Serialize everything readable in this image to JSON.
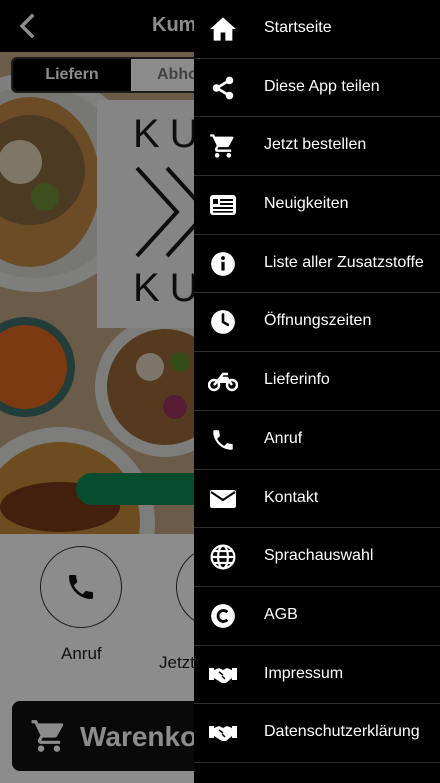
{
  "header": {
    "title": "Kumpel",
    "back_icon": "chevron-left-icon"
  },
  "delivery_toggle": {
    "options": [
      "Liefern",
      "Abholung"
    ],
    "selected": "Liefern"
  },
  "logo": {
    "line1": "KU",
    "line2": "KU"
  },
  "actions": [
    {
      "label": "Anruf",
      "icon": "phone-icon"
    },
    {
      "label": "Jetzt bestellen",
      "icon": "cart-icon"
    }
  ],
  "cart": {
    "label": "Warenkorb",
    "icon": "cart-icon"
  },
  "drawer": {
    "items": [
      {
        "label": "Startseite",
        "icon": "home-icon"
      },
      {
        "label": "Diese App teilen",
        "icon": "share-icon"
      },
      {
        "label": "Jetzt bestellen",
        "icon": "cart-icon"
      },
      {
        "label": "Neuigkeiten",
        "icon": "newspaper-icon"
      },
      {
        "label": "Liste aller Zusatzstoffe",
        "icon": "info-icon"
      },
      {
        "label": "Öffnungszeiten",
        "icon": "clock-icon"
      },
      {
        "label": "Lieferinfo",
        "icon": "motorcycle-icon"
      },
      {
        "label": "Anruf",
        "icon": "phone-icon"
      },
      {
        "label": "Kontakt",
        "icon": "envelope-icon"
      },
      {
        "label": "Sprachauswahl",
        "icon": "globe-icon"
      },
      {
        "label": "AGB",
        "icon": "copyright-icon"
      },
      {
        "label": "Impressum",
        "icon": "handshake-icon"
      },
      {
        "label": "Datenschutzerklärung",
        "icon": "handshake-icon"
      }
    ]
  },
  "colors": {
    "drawer_bg": "#000000",
    "accent_green": "#0c8a56",
    "text_light": "#ffffff"
  }
}
